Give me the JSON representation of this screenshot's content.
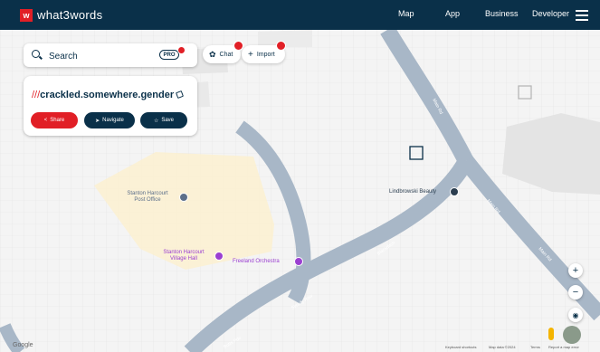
{
  "header": {
    "logo_text": "what3words",
    "logo_mark": "w",
    "nav": [
      "Map",
      "App",
      "Business",
      "Developer"
    ]
  },
  "search": {
    "placeholder": "Search",
    "pro_label": "PRO"
  },
  "actions": {
    "chat_label": "Chat",
    "import_label": "Import"
  },
  "address": {
    "slashes": "///",
    "words": "crackled.somewhere.gender",
    "share_label": "Share",
    "navigate_label": "Navigate",
    "save_label": "Save"
  },
  "map": {
    "pois": [
      {
        "name": "Stanton Harcourt\nPost Office",
        "color": "#5c6f8a"
      },
      {
        "name": "Stanton Harcourt\nVillage Hall",
        "color": "#9b3fd1"
      },
      {
        "name": "Freeland Orchestra",
        "color": "#9b3fd1"
      },
      {
        "name": "Lindbrowski Beauty",
        "color": "#2a3d4f"
      }
    ],
    "roads": [
      "Main Rd",
      "Main Rd",
      "Blackditch",
      "Steady Row",
      "Main Rd",
      "Butts Pdo"
    ]
  },
  "controls": {
    "zoom_in": "+",
    "zoom_out": "−"
  },
  "footer": {
    "google": "Google",
    "attribution": "Keyboard shortcuts",
    "map_data": "Map data ©2024",
    "terms": "Terms",
    "report": "Report a map error"
  },
  "colors": {
    "brand_navy": "#0a3049",
    "brand_red": "#e11f26",
    "road": "#a8b7c7",
    "highlight_area": "#fbf0d0"
  }
}
